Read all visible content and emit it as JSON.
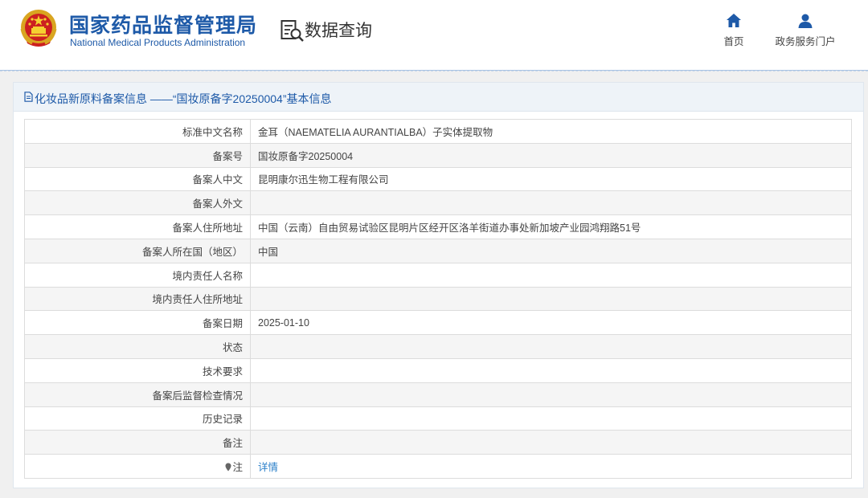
{
  "header": {
    "org_name_cn": "国家药品监督管理局",
    "org_name_en": "National Medical Products Administration",
    "emblem_icon": "national-emblem-icon",
    "query_icon": "data-search-icon",
    "query_title": "数据查询",
    "nav": [
      {
        "label": "首页",
        "icon": "home-icon"
      },
      {
        "label": "政务服务门户",
        "icon": "user-icon"
      }
    ]
  },
  "panel": {
    "title_icon": "document-icon",
    "title": "化妆品新原料备案信息 ——“国妆原备字20250004”基本信息",
    "rows": [
      {
        "key": "标准中文名称",
        "value": "金耳（NAEMATELIA AURANTIALBA）子实体提取物"
      },
      {
        "key": "备案号",
        "value": "国妆原备字20250004"
      },
      {
        "key": "备案人中文",
        "value": "昆明康尔迅生物工程有限公司"
      },
      {
        "key": "备案人外文",
        "value": ""
      },
      {
        "key": "备案人住所地址",
        "value": "中国（云南）自由贸易试验区昆明片区经开区洛羊街道办事处新加坡产业园鸿翔路51号"
      },
      {
        "key": "备案人所在国（地区）",
        "value": "中国"
      },
      {
        "key": "境内责任人名称",
        "value": ""
      },
      {
        "key": "境内责任人住所地址",
        "value": ""
      },
      {
        "key": "备案日期",
        "value": "2025-01-10"
      },
      {
        "key": "状态",
        "value": ""
      },
      {
        "key": "技术要求",
        "value": ""
      },
      {
        "key": "备案后监督检查情况",
        "value": ""
      },
      {
        "key": "历史记录",
        "value": ""
      },
      {
        "key": "备注",
        "value": ""
      },
      {
        "key": "注",
        "value": "详情",
        "key_icon": "location-pin-icon"
      }
    ]
  },
  "colors": {
    "brand_blue": "#1e5aa8",
    "link_blue": "#2a7fc9",
    "panel_head_bg": "#eef3f8",
    "row_alt_bg": "#f5f5f5"
  }
}
